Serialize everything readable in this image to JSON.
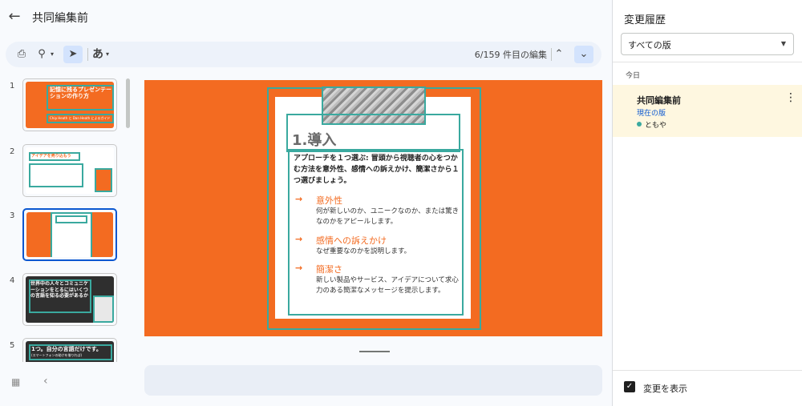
{
  "header": {
    "back_icon": "arrow-left-icon",
    "title": "共同編集前"
  },
  "toolbar": {
    "print_icon": "print-icon",
    "zoom_icon": "zoom-icon",
    "pointer_icon": "pointer-icon",
    "ime_label": "あ",
    "edit_count": "6/159 件目の編集",
    "up_icon": "chevron-up-icon",
    "down_icon": "chevron-down-icon"
  },
  "filmstrip": {
    "slides": [
      {
        "number": "1",
        "title": "記憶に残るプレゼンテーションの作り方",
        "subtitle": "Chip Heath と Dan Heath によるガイド"
      },
      {
        "number": "2",
        "title": "アイデアを売り込もう"
      },
      {
        "number": "3",
        "title": ""
      },
      {
        "number": "4",
        "title": "世界中の人々とコミュニケーションをとるにはいくつの言語を知る必要があるか"
      },
      {
        "number": "5",
        "title": "1つ。自分の言語だけです。",
        "subtitle": "(スマートフォンの助けを借りれば)"
      }
    ],
    "grid_icon": "grid-view-icon",
    "collapse_icon": "chevron-left-icon"
  },
  "slide": {
    "heading": "1.導入",
    "lead": "アプローチを１つ選ぶ: 冒頭から視聴者の心をつかむ方法を意外性、感情への訴えかけ、簡潔さから１つ選びましょう。",
    "bullets": [
      {
        "arrow": "→",
        "title": "意外性",
        "body": "何が新しいのか、ユニークなのか、または驚きなのかをアピールします。"
      },
      {
        "arrow": "→",
        "title": "感情への訴えかけ",
        "body": "なぜ重要なのかを説明します。"
      },
      {
        "arrow": "→",
        "title": "簡潔さ",
        "body": "新しい製品やサービス、アイデアについて求心力のある簡潔なメッセージを提示します。"
      }
    ]
  },
  "history": {
    "title": "変更履歴",
    "filter_value": "すべての版",
    "today_label": "今日",
    "version": {
      "name": "共同編集前",
      "current_label": "現在の版",
      "user": "ともや"
    },
    "show_changes_label": "変更を表示",
    "show_changes_checked": true
  },
  "colors": {
    "accent": "#f36b21",
    "highlight": "#3aa99f",
    "primary": "#0b57d0",
    "selected_version": "#fef7e0"
  }
}
